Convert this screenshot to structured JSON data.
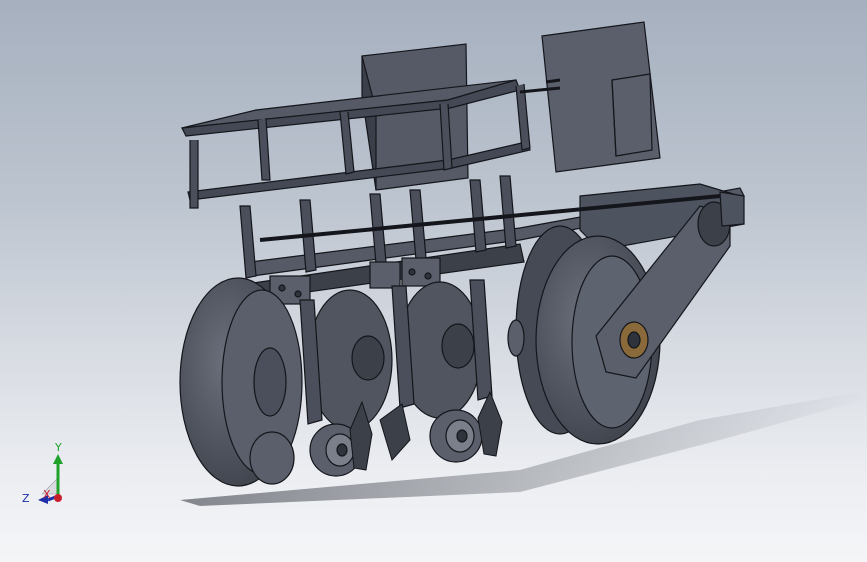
{
  "scene": {
    "model": "planter-assembly",
    "body_color": "#4e5360",
    "body_light": "#6a6f7b",
    "body_dark": "#2f333c",
    "edge_color": "#14161b",
    "shadow_color": "#2a2f38"
  },
  "triad": {
    "y_label": "Y",
    "x_label": "X",
    "z_label": "Z",
    "y_color": "#1fa12a",
    "x_color": "#c8202a",
    "z_color": "#1d2fa8"
  }
}
